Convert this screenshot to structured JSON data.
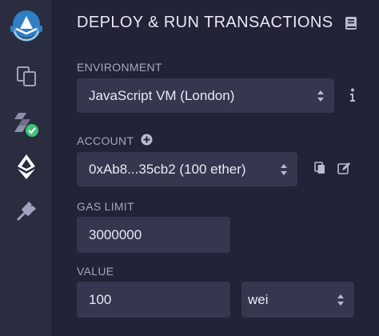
{
  "panel": {
    "title": "DEPLOY & RUN TRANSACTIONS"
  },
  "sidebar": {
    "items": [
      {
        "name": "logo",
        "icon": "remix-logo-icon"
      },
      {
        "name": "file-explorer",
        "icon": "files-icon"
      },
      {
        "name": "solidity-compiler",
        "icon": "compile-success-icon"
      },
      {
        "name": "deploy-run",
        "icon": "ethereum-icon",
        "active": true
      },
      {
        "name": "plugin-manager",
        "icon": "plug-icon"
      }
    ]
  },
  "environment": {
    "label": "ENVIRONMENT",
    "selected": "JavaScript VM (London)",
    "info_icon": "info-icon"
  },
  "account": {
    "label": "ACCOUNT",
    "add_icon": "plus-circle-icon",
    "selected": "0xAb8...35cb2 (100 ether)",
    "copy_icon": "copy-icon",
    "edit_icon": "edit-icon"
  },
  "gas_limit": {
    "label": "GAS LIMIT",
    "value": "3000000"
  },
  "value": {
    "label": "VALUE",
    "amount": "100",
    "unit": "wei"
  },
  "colors": {
    "background": "#222336",
    "sidebar": "#2a2c3f",
    "field": "#35374f",
    "accent_blue": "#2f7fc2",
    "success_green": "#3ec27a"
  }
}
